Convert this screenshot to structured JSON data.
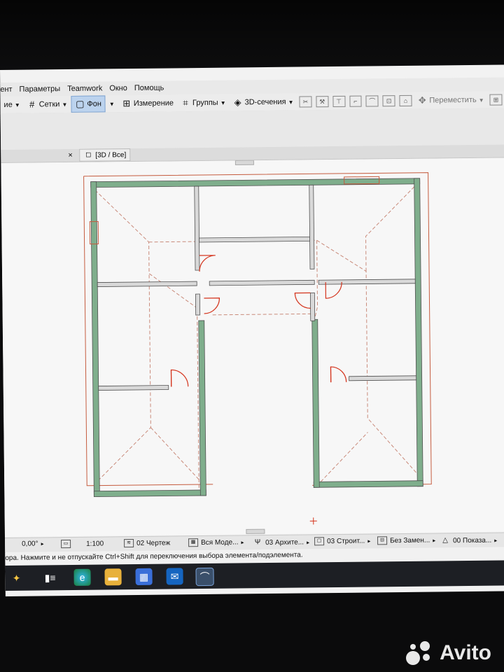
{
  "menu": {
    "items": [
      "ент",
      "Параметры",
      "Teamwork",
      "Окно",
      "Помощь"
    ]
  },
  "toolbar": {
    "item0_label": "ие",
    "grids_label": "Сетки",
    "background_label": "Фон",
    "measure_label": "Измерение",
    "groups_label": "Группы",
    "sections3d_label": "3D-сечения",
    "move_label": "Переместить"
  },
  "tab": {
    "label": "[3D / Все]",
    "close_symbol": "×"
  },
  "statusbar": {
    "angle": "0,00°",
    "scale": "1:100",
    "layer_set": "02 Чертеж",
    "model": "Вся Моде...",
    "pen_set": "03 Архите...",
    "structure": "03 Строит...",
    "renovation": "Без Замен...",
    "show": "00 Показа..."
  },
  "hint": {
    "text": "ора. Нажмите и не отпускайте Ctrl+Shift для переключения выбора элемента/подэлемента."
  },
  "watermark": {
    "brand": "Avito"
  },
  "colors": {
    "wall_fill": "#7fae8c",
    "wall_outline": "#505050",
    "roof_dash": "#c98a7a",
    "door_swing": "#d4331c",
    "ui_gray": "#e9e9e9",
    "taskbar": "#1d1f24"
  }
}
